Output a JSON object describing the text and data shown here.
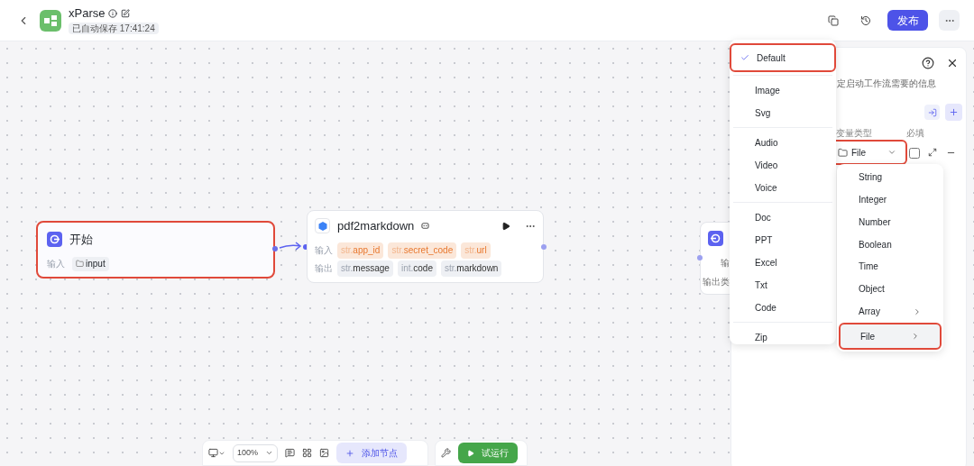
{
  "header": {
    "title": "xParse",
    "autosave": "已自动保存 17:41:24",
    "publish": "发布"
  },
  "start_node": {
    "title": "开始",
    "highlighted": true,
    "input_label": "输入",
    "inputs": [
      {
        "name": "input"
      }
    ]
  },
  "tool_node": {
    "title": "pdf2markdown",
    "input_label": "输入",
    "output_label": "输出",
    "inputs": [
      {
        "type": "str.",
        "name": "app_id"
      },
      {
        "type": "str.",
        "name": "secret_code"
      },
      {
        "type": "str.",
        "name": "url"
      }
    ],
    "outputs": [
      {
        "type": "str.",
        "name": "message"
      },
      {
        "type": "int.",
        "name": "code"
      },
      {
        "type": "str.",
        "name": "markdown"
      }
    ]
  },
  "end_node": {
    "input_label": "输",
    "output_label": "输出类"
  },
  "panel": {
    "description": "定启动工作流需要的信息",
    "columns": [
      "变量类型",
      "必填"
    ],
    "variable": {
      "type": "File",
      "highlighted": true,
      "required": false
    }
  },
  "type_menu": [
    {
      "label": "String",
      "submenu": false,
      "selected": false,
      "highlighted": false
    },
    {
      "label": "Integer",
      "submenu": false,
      "selected": false,
      "highlighted": false
    },
    {
      "label": "Number",
      "submenu": false,
      "selected": false,
      "highlighted": false
    },
    {
      "label": "Boolean",
      "submenu": false,
      "selected": false,
      "highlighted": false
    },
    {
      "label": "Time",
      "submenu": false,
      "selected": false,
      "highlighted": false
    },
    {
      "label": "Object",
      "submenu": false,
      "selected": false,
      "highlighted": false
    },
    {
      "label": "Array",
      "submenu": true,
      "selected": false,
      "highlighted": false
    },
    {
      "label": "File",
      "submenu": true,
      "selected": true,
      "highlighted": true
    }
  ],
  "file_menu": [
    [
      {
        "label": "Default",
        "selected": true,
        "highlighted": true
      }
    ],
    [
      {
        "label": "Image",
        "selected": false,
        "highlighted": false
      },
      {
        "label": "Svg",
        "selected": false,
        "highlighted": false
      }
    ],
    [
      {
        "label": "Audio",
        "selected": false,
        "highlighted": false
      },
      {
        "label": "Video",
        "selected": false,
        "highlighted": false
      },
      {
        "label": "Voice",
        "selected": false,
        "highlighted": false
      }
    ],
    [
      {
        "label": "Doc",
        "selected": false,
        "highlighted": false
      },
      {
        "label": "PPT",
        "selected": false,
        "highlighted": false
      },
      {
        "label": "Excel",
        "selected": false,
        "highlighted": false
      },
      {
        "label": "Txt",
        "selected": false,
        "highlighted": false
      },
      {
        "label": "Code",
        "selected": false,
        "highlighted": false
      }
    ],
    [
      {
        "label": "Zip",
        "selected": false,
        "highlighted": false
      }
    ]
  ],
  "toolbar": {
    "zoom": "100%",
    "add_node": "添加节点",
    "run": "试运行"
  }
}
